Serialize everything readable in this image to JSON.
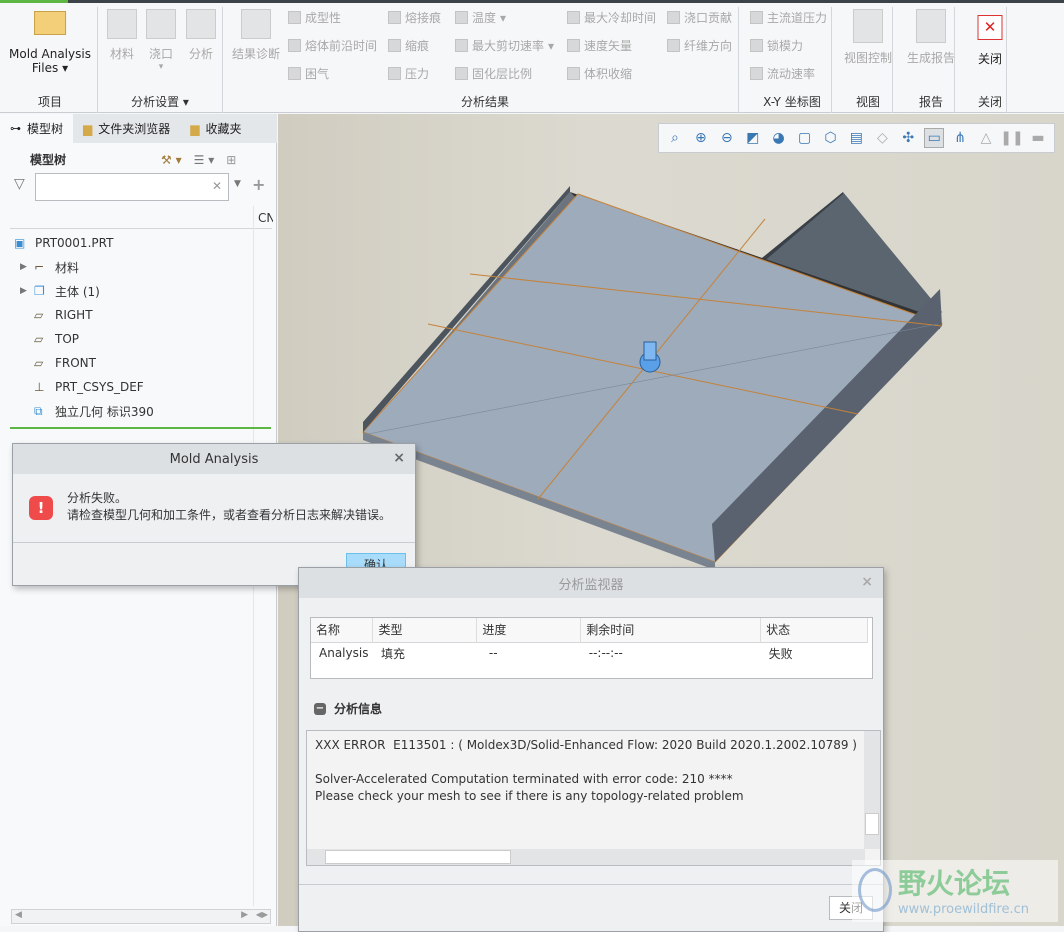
{
  "ribbon": {
    "project": {
      "files_label_1": "Mold Analysis",
      "files_label_2": "Files",
      "group_label": "项目"
    },
    "analysis_setup": {
      "items": [
        "材料",
        "浇口",
        "分析"
      ],
      "group_label": "分析设置"
    },
    "analysis_results": {
      "diagnose": "结果诊断",
      "col1": [
        "成型性",
        "熔体前沿时间",
        "困气"
      ],
      "col2": [
        "熔接痕",
        "缩痕",
        "压力"
      ],
      "col3": [
        "温度",
        "最大剪切速率",
        "固化层比例"
      ],
      "col4": [
        "最大冷却时间",
        "速度矢量",
        "体积收缩"
      ],
      "col5": [
        "浇口贡献",
        "纤维方向"
      ],
      "group_label": "分析结果"
    },
    "xy_plot": {
      "items": [
        "主流道压力",
        "锁模力",
        "流动速率"
      ],
      "group_label": "X-Y 坐标图"
    },
    "view": {
      "item": "视图控制",
      "group_label": "视图"
    },
    "report": {
      "item": "生成报告",
      "group_label": "报告"
    },
    "close": {
      "item": "关闭",
      "group_label": "关闭"
    }
  },
  "left_panel": {
    "tabs": [
      "模型树",
      "文件夹浏览器",
      "收藏夹"
    ],
    "title": "模型树",
    "search_value": "",
    "column_header": "CN",
    "tree": [
      {
        "label": "PRT0001.PRT",
        "icon": "part-icon"
      },
      {
        "label": "材料",
        "icon": "material-icon",
        "expandable": true
      },
      {
        "label": "主体 (1)",
        "icon": "body-icon",
        "expandable": true
      },
      {
        "label": "RIGHT",
        "icon": "datum-plane-icon"
      },
      {
        "label": "TOP",
        "icon": "datum-plane-icon"
      },
      {
        "label": "FRONT",
        "icon": "datum-plane-icon"
      },
      {
        "label": "PRT_CSYS_DEF",
        "icon": "csys-icon"
      },
      {
        "label": "独立几何 标识390",
        "icon": "independent-geometry-icon"
      }
    ]
  },
  "view_toolbar": {
    "icons": [
      "refit-icon",
      "zoom-in-icon",
      "zoom-out-icon",
      "repaint-icon",
      "display-style-icon",
      "saved-orientations-icon",
      "named-views-icon",
      "view-manager-icon",
      "perspective-icon",
      "datum-display-icon",
      "annotation-display-icon",
      "spin-center-icon",
      "simulation-icon",
      "pause-icon",
      "render-icon"
    ]
  },
  "error_dialog": {
    "title": "Mold Analysis",
    "line1": "分析失败。",
    "line2": "请检查模型几何和加工条件，或者查看分析日志来解决错误。",
    "ok": "确认",
    "error_color": "#f04b4b"
  },
  "monitor": {
    "title": "分析监视器",
    "columns": [
      "名称",
      "类型",
      "进度",
      "剩余时间",
      "状态"
    ],
    "rows": [
      [
        "Analysis",
        "填充",
        "--",
        "--:--:--",
        "失败"
      ]
    ],
    "info_title": "分析信息",
    "log": [
      "XXX ERROR  E113501 : ( Moldex3D/Solid-Enhanced Flow: 2020 Build 2020.1.2002.10789 )",
      "",
      "Solver-Accelerated Computation terminated with error code: 210 ****",
      "Please check your mesh to see if there is any topology-related problem"
    ],
    "close": "关闭"
  },
  "watermark": {
    "text": "野火论坛",
    "url": "www.proewildfire.cn"
  }
}
